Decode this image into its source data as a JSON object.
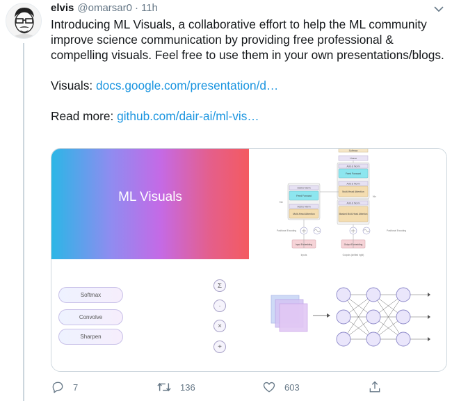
{
  "tweet": {
    "author_name": "elvis",
    "author_handle": "@omarsar0",
    "separator": "·",
    "time": "11h",
    "text_intro": "Introducing ML Visuals, a collaborative effort to help the ML community improve science communication by providing free professional & compelling visuals. Feel free to use them in your own presentations/blogs.",
    "visuals_label": "Visuals:",
    "visuals_link": "docs.google.com/presentation/d…",
    "readmore_label": "Read more:",
    "readmore_link": "github.com/dair-ai/ml-vis…"
  },
  "media": {
    "tile1_title": "ML Visuals",
    "transformer": {
      "softmax": "Softmax",
      "linear": "Linear",
      "add_norm": "Add & Norm",
      "feed_forward": "Feed Forward",
      "multi_head": "Multi-Head Attention",
      "masked_multi_head": "Masked Multi-Head Attention",
      "positional_encoding": "Positional Encoding",
      "input_embedding": "Input Embedding",
      "output_embedding": "Output Embedding",
      "inputs": "Inputs",
      "outputs": "Outputs (shifted right)",
      "nx": "N×"
    },
    "pills": [
      "Softmax",
      "Convolve",
      "Sharpen"
    ],
    "ops_icons": [
      {
        "icon": "sum-icon",
        "glyph": "Σ"
      },
      {
        "icon": "dot-icon",
        "glyph": "·"
      },
      {
        "icon": "multiply-icon",
        "glyph": "×"
      },
      {
        "icon": "plus-icon",
        "glyph": "+"
      }
    ]
  },
  "actions": {
    "reply_count": "7",
    "retweet_count": "136",
    "like_count": "603"
  },
  "colors": {
    "link": "#1b95e0",
    "secondary_text": "#657786",
    "gradient": [
      "#2bb6e6",
      "#c46ae6",
      "#f45a60"
    ]
  }
}
